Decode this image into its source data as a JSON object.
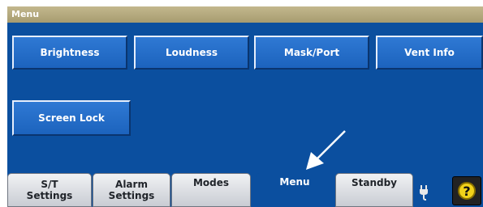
{
  "title": "Menu",
  "buttons": {
    "brightness": "Brightness",
    "loudness": "Loudness",
    "mask_port": "Mask/Port",
    "vent_info": "Vent Info",
    "screen_lock": "Screen Lock"
  },
  "tabs": {
    "st_line1": "S/T",
    "st_line2": "Settings",
    "alarm_line1": "Alarm",
    "alarm_line2": "Settings",
    "modes": "Modes",
    "menu": "Menu",
    "standby": "Standby"
  },
  "icons": {
    "help": "?",
    "plug": "plug-icon",
    "arrow": "pointer-arrow-icon"
  },
  "colors": {
    "screen_blue": "#0b4f9f",
    "title_bar": "#b5aa7e",
    "help_yellow": "#f2d21a"
  }
}
